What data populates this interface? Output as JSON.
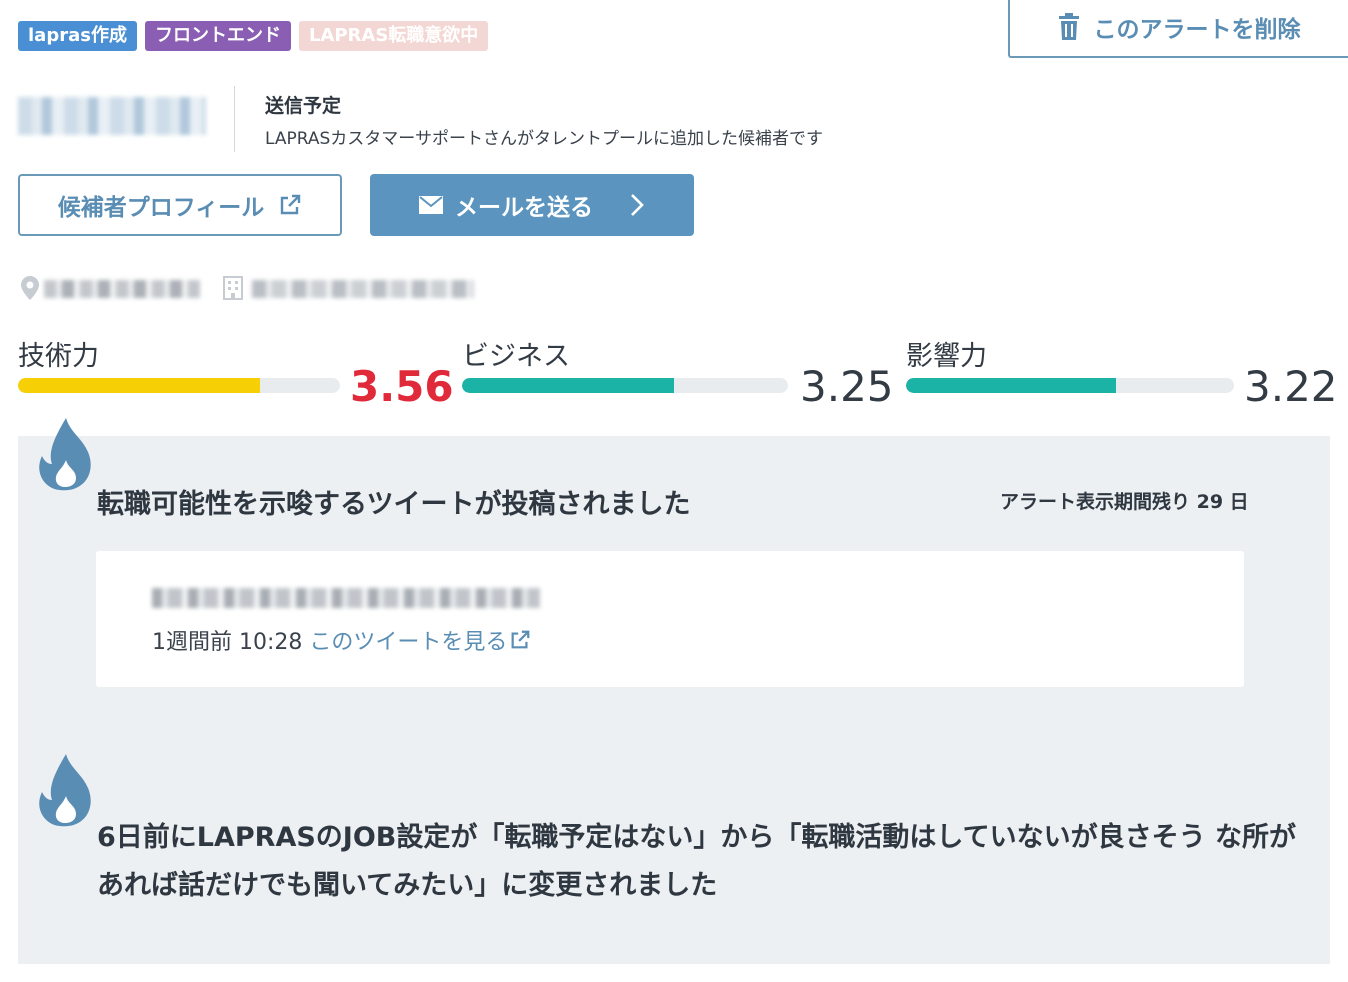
{
  "tags": [
    {
      "label": "lapras作成",
      "color": "#4a8fd4"
    },
    {
      "label": "フロントエンド",
      "color": "#8a5fb3"
    },
    {
      "label": "LAPRAS転職意欲中",
      "color": "#f3d7d4"
    }
  ],
  "delete_alert": {
    "label": "このアラートを削除",
    "icon": "trash-icon"
  },
  "candidate": {
    "send_status": "送信予定",
    "description": "LAPRASカスタマーサポートさんがタレントプールに追加した候補者です"
  },
  "buttons": {
    "profile": {
      "label": "候補者プロフィール",
      "icon": "external-link-icon"
    },
    "mail": {
      "label": "メールを送る",
      "icon": "envelope-icon",
      "trail_icon": "chevron-right-icon"
    }
  },
  "info_icons": {
    "location": "map-pin-icon",
    "company": "building-icon"
  },
  "scores": [
    {
      "label": "技術力",
      "value": "3.56",
      "fraction": 0.75,
      "bar_color": "#f7cf05",
      "value_color": "#e02a3a"
    },
    {
      "label": "ビジネス",
      "value": "3.25",
      "fraction": 0.65,
      "bar_color": "#1ab3a6",
      "value_color": "#333b45"
    },
    {
      "label": "影響力",
      "value": "3.22",
      "fraction": 0.64,
      "bar_color": "#1ab3a6",
      "value_color": "#333b45"
    }
  ],
  "alerts": [
    {
      "title": "転職可能性を示唆するツイートが投稿されました",
      "remaining": "アラート表示期間残り 29 日",
      "tweet_time": "1週間前 10:28",
      "tweet_link": "このツイートを見る",
      "icon": "fire-icon"
    },
    {
      "text": "6日前にLAPRASのJOB設定が「転職予定はない」から「転職活動はしていないが良さそう な所があれば話だけでも聞いてみたい」に変更されました",
      "icon": "fire-icon"
    }
  ]
}
